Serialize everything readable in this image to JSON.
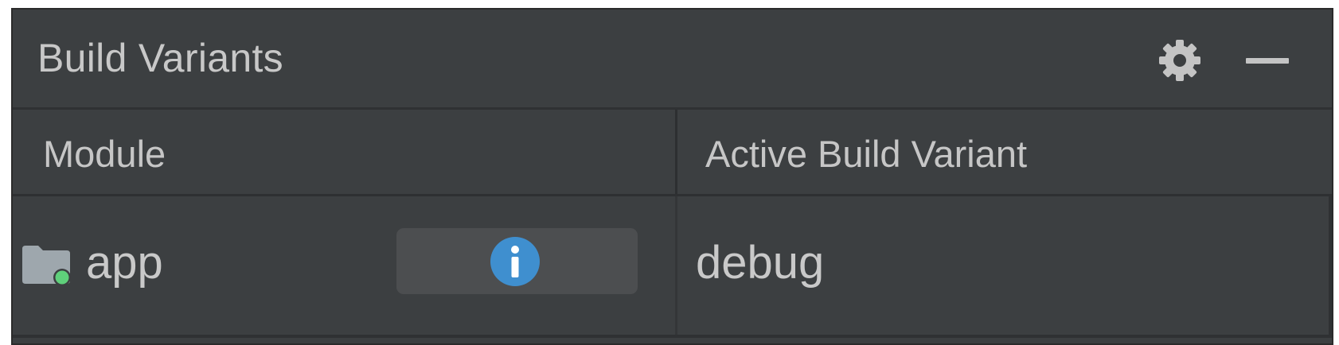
{
  "panel": {
    "title": "Build Variants",
    "actions": {
      "settings_icon": "gear-icon",
      "minimize_icon": "minimize-icon"
    }
  },
  "table": {
    "columns": [
      "Module",
      "Active Build Variant"
    ],
    "rows": [
      {
        "module": "app",
        "module_icon": "android-module-folder-icon",
        "info_icon": "info-icon",
        "active_build_variant": "debug"
      }
    ]
  },
  "colors": {
    "panel_background": "#3c3f41",
    "text": "#c8c8c8",
    "info_blue": "#3f8fcf",
    "module_indicator_green": "#5fd07b",
    "button_background": "#4c4e50"
  }
}
